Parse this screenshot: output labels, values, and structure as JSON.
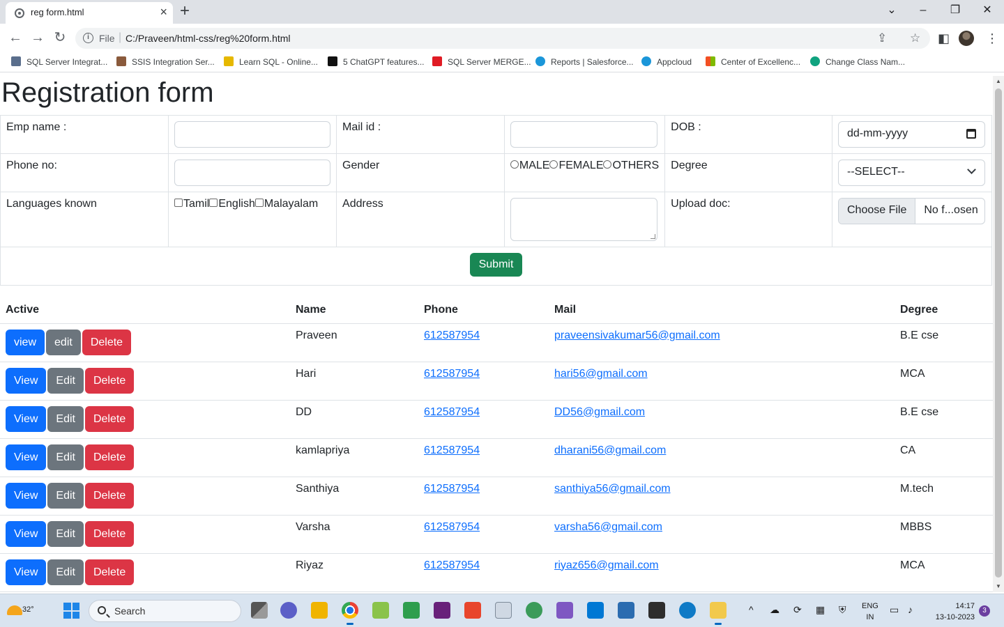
{
  "browser": {
    "tab_title": "reg form.html",
    "url_scheme": "File",
    "url": "C:/Praveen/html-css/reg%20form.html",
    "bookmarks": [
      {
        "label": "SQL Server Integrat...",
        "icon": "sql-server-icon",
        "color": "#5a6e8c"
      },
      {
        "label": "SSIS Integration Ser...",
        "icon": "ssis-icon",
        "color": "#8a5a3c"
      },
      {
        "label": "Learn SQL - Online...",
        "icon": "learn-sql-icon",
        "color": "#e6b800"
      },
      {
        "label": "5 ChatGPT features...",
        "icon": "chatgpt-icon",
        "color": "#111111"
      },
      {
        "label": "SQL Server MERGE...",
        "icon": "merge-icon",
        "color": "#e01b24"
      },
      {
        "label": "Reports | Salesforce...",
        "icon": "salesforce-icon",
        "color": "#1b96d9"
      },
      {
        "label": "Appcloud",
        "icon": "appcloud-icon",
        "color": "#1b96d9"
      },
      {
        "label": "Center of Excellenc...",
        "icon": "microsoft-icon",
        "color": "#f25022"
      },
      {
        "label": "Change Class Nam...",
        "icon": "openai-icon",
        "color": "#10a37f"
      }
    ]
  },
  "page": {
    "title": "Registration form",
    "form": {
      "emp_name_label": "Emp name :",
      "mail_label": "Mail id :",
      "dob_label": "DOB :",
      "dob_placeholder": "dd-mm-yyyy",
      "phone_label": "Phone no:",
      "gender_label": "Gender",
      "gender_options": [
        "MALE",
        "FEMALE",
        "OTHERS"
      ],
      "degree_label": "Degree",
      "degree_selected": "--SELECT--",
      "languages_label": "Languages known",
      "language_options": [
        "Tamil",
        "English",
        "Malayalam"
      ],
      "address_label": "Address",
      "upload_label": "Upload doc:",
      "choose_file": "Choose File",
      "file_status": "No f...osen",
      "submit": "Submit"
    },
    "table": {
      "headers": {
        "active": "Active",
        "name": "Name",
        "phone": "Phone",
        "mail": "Mail",
        "degree": "Degree"
      },
      "rows": [
        {
          "view": "view",
          "edit": "edit",
          "delete": "Delete",
          "name": "Praveen",
          "phone": "612587954",
          "mail": "praveensivakumar56@gmail.com",
          "degree": "B.E cse"
        },
        {
          "view": "View",
          "edit": "Edit",
          "delete": "Delete",
          "name": "Hari",
          "phone": "612587954",
          "mail": "hari56@gmail.com",
          "degree": "MCA"
        },
        {
          "view": "View",
          "edit": "Edit",
          "delete": "Delete",
          "name": "DD",
          "phone": "612587954",
          "mail": "DD56@gmail.com",
          "degree": "B.E cse"
        },
        {
          "view": "View",
          "edit": "Edit",
          "delete": "Delete",
          "name": "kamlapriya",
          "phone": "612587954",
          "mail": "dharani56@gmail.com",
          "degree": "CA"
        },
        {
          "view": "View",
          "edit": "Edit",
          "delete": "Delete",
          "name": "Santhiya",
          "phone": "612587954",
          "mail": "santhiya56@gmail.com",
          "degree": "M.tech"
        },
        {
          "view": "View",
          "edit": "Edit",
          "delete": "Delete",
          "name": "Varsha",
          "phone": "612587954",
          "mail": "varsha56@gmail.com",
          "degree": "MBBS"
        },
        {
          "view": "View",
          "edit": "Edit",
          "delete": "Delete",
          "name": "Riyaz",
          "phone": "612587954",
          "mail": "riyaz656@gmail.com",
          "degree": "MCA"
        }
      ]
    }
  },
  "taskbar": {
    "temperature": "32°",
    "search_label": "Search",
    "lang_line1": "ENG",
    "lang_line2": "IN",
    "time": "14:17",
    "date": "13-10-2023",
    "notification_count": "3"
  },
  "colors": {
    "primary": "#0d6efd",
    "secondary": "#6c757d",
    "danger": "#dc3545",
    "success": "#198754"
  }
}
